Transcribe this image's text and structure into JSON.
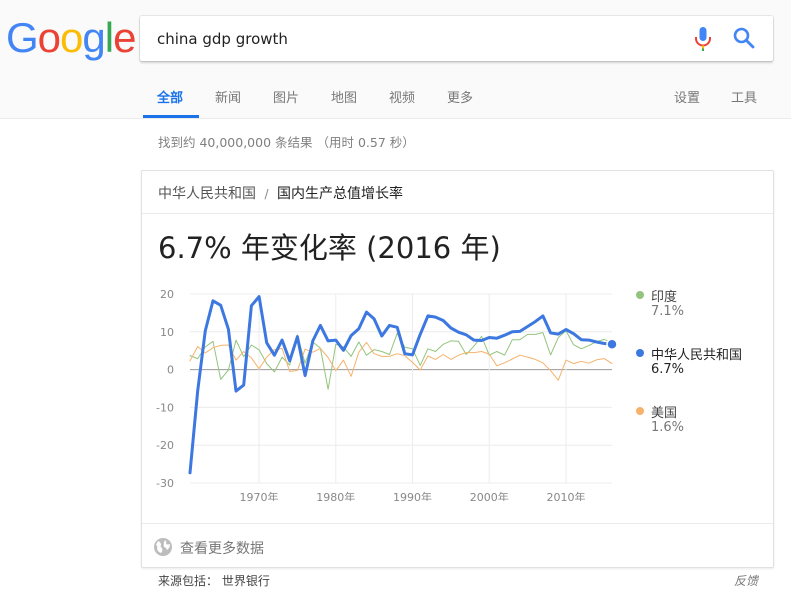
{
  "logo_text": "Google",
  "search": {
    "query": "china gdp growth"
  },
  "tabs": [
    {
      "label": "全部"
    },
    {
      "label": "新闻"
    },
    {
      "label": "图片"
    },
    {
      "label": "地图"
    },
    {
      "label": "视频"
    },
    {
      "label": "更多"
    },
    {
      "label": "设置"
    },
    {
      "label": "工具"
    }
  ],
  "result_stats": "找到约 40,000,000 条结果  （用时 0.57 秒）",
  "card": {
    "breadcrumb_parent": "中华人民共和国",
    "breadcrumb_sep": "/",
    "breadcrumb_current": "国内生产总值增长率",
    "headline": "6.7% 年变化率 (2016 年)",
    "more_data": "查看更多数据"
  },
  "sources": "来源包括：  世界银行",
  "feedback": "反馈",
  "colors": {
    "china": "#3c78e0",
    "india": "#93c47d",
    "usa": "#f6b26b",
    "accent": "#1a73e8"
  },
  "chart_data": {
    "type": "line",
    "x_tick_labels": [
      "1970年",
      "1980年",
      "1990年",
      "2000年",
      "2010年"
    ],
    "x_ticks": [
      1970,
      1980,
      1990,
      2000,
      2010
    ],
    "y_ticks": [
      20,
      10,
      0,
      -10,
      -20,
      -30
    ],
    "xlim": [
      1961,
      2016
    ],
    "ylim": [
      -30,
      20
    ],
    "grid": true,
    "legend_placement": "right",
    "series": [
      {
        "name": "印度",
        "value_label": "7.1%",
        "color": "#93c47d",
        "highlight": false,
        "x": [
          1961,
          1962,
          1963,
          1964,
          1965,
          1966,
          1967,
          1968,
          1969,
          1970,
          1971,
          1972,
          1973,
          1974,
          1975,
          1976,
          1977,
          1978,
          1979,
          1980,
          1981,
          1982,
          1983,
          1984,
          1985,
          1986,
          1987,
          1988,
          1989,
          1990,
          1991,
          1992,
          1993,
          1994,
          1995,
          1996,
          1997,
          1998,
          1999,
          2000,
          2001,
          2002,
          2003,
          2004,
          2005,
          2006,
          2007,
          2008,
          2009,
          2010,
          2011,
          2012,
          2013,
          2014,
          2015,
          2016
        ],
        "values": [
          3.7,
          2.9,
          6.0,
          7.5,
          -2.6,
          -0.1,
          7.8,
          3.4,
          6.5,
          5.2,
          1.6,
          -0.6,
          3.3,
          1.2,
          9.2,
          1.7,
          7.3,
          5.7,
          -5.2,
          6.7,
          6.0,
          3.5,
          7.3,
          3.8,
          5.3,
          4.8,
          4.0,
          9.6,
          5.9,
          5.5,
          1.1,
          5.5,
          4.8,
          6.7,
          7.6,
          7.5,
          4.0,
          6.2,
          8.8,
          3.8,
          4.8,
          3.8,
          7.9,
          7.9,
          9.3,
          9.3,
          9.8,
          3.9,
          8.5,
          10.3,
          6.6,
          5.5,
          6.4,
          7.4,
          8.0,
          7.1
        ]
      },
      {
        "name": "中华人民共和国",
        "value_label": "6.7%",
        "color": "#3c78e0",
        "highlight": true,
        "x": [
          1961,
          1962,
          1963,
          1964,
          1965,
          1966,
          1967,
          1968,
          1969,
          1970,
          1971,
          1972,
          1973,
          1974,
          1975,
          1976,
          1977,
          1978,
          1979,
          1980,
          1981,
          1982,
          1983,
          1984,
          1985,
          1986,
          1987,
          1988,
          1989,
          1990,
          1991,
          1992,
          1993,
          1994,
          1995,
          1996,
          1997,
          1998,
          1999,
          2000,
          2001,
          2002,
          2003,
          2004,
          2005,
          2006,
          2007,
          2008,
          2009,
          2010,
          2011,
          2012,
          2013,
          2014,
          2015,
          2016
        ],
        "values": [
          -27.3,
          -5.6,
          10.3,
          18.2,
          17.0,
          10.7,
          -5.7,
          -4.1,
          16.9,
          19.3,
          7.1,
          3.8,
          7.8,
          2.3,
          8.7,
          -1.6,
          7.6,
          11.7,
          7.6,
          7.8,
          5.1,
          9.0,
          10.8,
          15.2,
          13.4,
          8.9,
          11.7,
          11.2,
          4.2,
          3.9,
          9.3,
          14.2,
          13.9,
          13.0,
          11.0,
          9.9,
          9.2,
          7.8,
          7.7,
          8.5,
          8.3,
          9.1,
          10.0,
          10.1,
          11.4,
          12.7,
          14.2,
          9.7,
          9.4,
          10.6,
          9.5,
          7.9,
          7.8,
          7.3,
          6.9,
          6.7
        ]
      },
      {
        "name": "美国",
        "value_label": "1.6%",
        "color": "#f6b26b",
        "highlight": false,
        "x": [
          1961,
          1962,
          1963,
          1964,
          1965,
          1966,
          1967,
          1968,
          1969,
          1970,
          1971,
          1972,
          1973,
          1974,
          1975,
          1976,
          1977,
          1978,
          1979,
          1980,
          1981,
          1982,
          1983,
          1984,
          1985,
          1986,
          1987,
          1988,
          1989,
          1990,
          1991,
          1992,
          1993,
          1994,
          1995,
          1996,
          1997,
          1998,
          1999,
          2000,
          2001,
          2002,
          2003,
          2004,
          2005,
          2006,
          2007,
          2008,
          2009,
          2010,
          2011,
          2012,
          2013,
          2014,
          2015,
          2016
        ],
        "values": [
          2.3,
          6.1,
          4.4,
          5.8,
          6.4,
          6.5,
          2.5,
          4.8,
          3.1,
          0.2,
          3.3,
          5.3,
          5.6,
          -0.5,
          -0.2,
          5.4,
          4.6,
          5.6,
          3.2,
          -0.3,
          2.5,
          -1.8,
          4.6,
          7.2,
          4.2,
          3.5,
          3.5,
          4.2,
          3.7,
          1.9,
          -0.1,
          3.6,
          2.7,
          4.0,
          2.7,
          3.8,
          4.5,
          4.5,
          4.8,
          4.1,
          1.0,
          1.8,
          2.8,
          3.8,
          3.3,
          2.7,
          1.8,
          -0.3,
          -2.8,
          2.5,
          1.6,
          2.2,
          1.7,
          2.6,
          2.9,
          1.6
        ]
      }
    ]
  }
}
